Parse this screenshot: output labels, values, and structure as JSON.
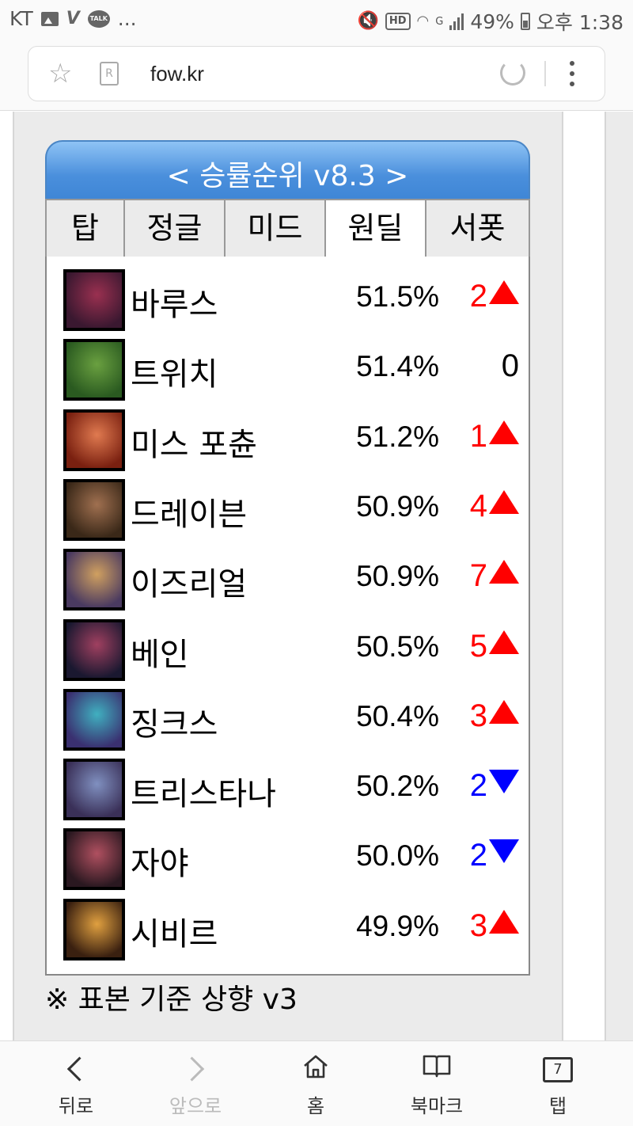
{
  "status_bar": {
    "carrier": "KT",
    "ellipsis": "...",
    "talk_label": "TALK",
    "hd_label": "HD",
    "network": "G",
    "battery": "49%",
    "time": "오후 1:38"
  },
  "browser": {
    "url": "fow.kr",
    "reader_label": "R"
  },
  "widget": {
    "title": "< 승률순위 v8.3 >",
    "tabs": [
      {
        "label": "탑",
        "active": false
      },
      {
        "label": "정글",
        "active": false
      },
      {
        "label": "미드",
        "active": false
      },
      {
        "label": "원딜",
        "active": true
      },
      {
        "label": "서폿",
        "active": false
      }
    ],
    "rows": [
      {
        "name": "바루스",
        "winrate": "51.5%",
        "change": "2",
        "direction": "up",
        "portrait_colors": [
          "#3a1830",
          "#9a3050"
        ]
      },
      {
        "name": "트위치",
        "winrate": "51.4%",
        "change": "0",
        "direction": "none",
        "portrait_colors": [
          "#2a5a20",
          "#6aa040"
        ]
      },
      {
        "name": "미스 포츈",
        "winrate": "51.2%",
        "change": "1",
        "direction": "up",
        "portrait_colors": [
          "#7a2010",
          "#e07a50"
        ]
      },
      {
        "name": "드레이븐",
        "winrate": "50.9%",
        "change": "4",
        "direction": "up",
        "portrait_colors": [
          "#3a2818",
          "#a07050"
        ]
      },
      {
        "name": "이즈리얼",
        "winrate": "50.9%",
        "change": "7",
        "direction": "up",
        "portrait_colors": [
          "#4a3a60",
          "#d0a060"
        ]
      },
      {
        "name": "베인",
        "winrate": "50.5%",
        "change": "5",
        "direction": "up",
        "portrait_colors": [
          "#1a1830",
          "#a04060"
        ]
      },
      {
        "name": "징크스",
        "winrate": "50.4%",
        "change": "3",
        "direction": "up",
        "portrait_colors": [
          "#3a3070",
          "#40b0c0"
        ]
      },
      {
        "name": "트리스타나",
        "winrate": "50.2%",
        "change": "2",
        "direction": "down",
        "portrait_colors": [
          "#3a3058",
          "#8090c0"
        ]
      },
      {
        "name": "자야",
        "winrate": "50.0%",
        "change": "2",
        "direction": "down",
        "portrait_colors": [
          "#2a1820",
          "#b05060"
        ]
      },
      {
        "name": "시비르",
        "winrate": "49.9%",
        "change": "3",
        "direction": "up",
        "portrait_colors": [
          "#3a2010",
          "#e0a040"
        ]
      }
    ],
    "colors": {
      "up": "#ff0000",
      "down": "#0000ff",
      "neutral": "#000000",
      "header_top": "#8ec3f5",
      "header_bottom": "#3f86d6"
    }
  },
  "footnote": "※ 표본 기준 상향 v3",
  "bottom_nav": {
    "back": "뒤로",
    "forward": "앞으로",
    "home": "홈",
    "bookmarks": "북마크",
    "tabs": "탭",
    "tab_count": "7"
  }
}
